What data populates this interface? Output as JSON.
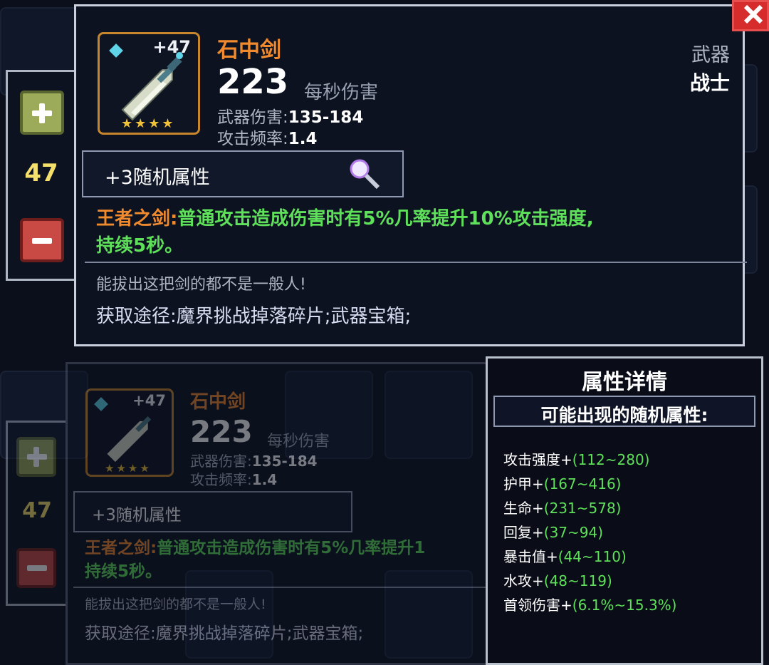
{
  "item": {
    "level": "+47",
    "name": "石中剑",
    "dps": "223",
    "dps_label": "每秒伤害",
    "weapon_damage_label": "武器伤害:",
    "weapon_damage": "135-184",
    "attack_rate_label": "攻击频率:",
    "attack_rate": "1.4",
    "category": "武器",
    "class": "战士",
    "stars": "★★★★",
    "random_attrs": "+3随机属性",
    "skill_name": "王者之剑:",
    "skill_text_line1": "普通攻击造成伤害时有5%几率提升10%攻击强度,",
    "skill_text_line2": "持续5秒。",
    "skill_text_short": "普通攻击造成伤害时有5%几率提升1",
    "flavor": "能拔出这把剑的都不是一般人!",
    "source": "获取途径:魔界挑战掉落碎片;武器宝箱;"
  },
  "side": {
    "qty": "47"
  },
  "attributes": {
    "title": "属性详情",
    "subtitle": "可能出现的随机属性:",
    "rows": [
      {
        "name": "攻击强度+",
        "range": "(112~280)"
      },
      {
        "name": "护甲+",
        "range": "(167~416)"
      },
      {
        "name": "生命+",
        "range": "(231~578)"
      },
      {
        "name": "回复+",
        "range": "(37~94)"
      },
      {
        "name": "暴击值+",
        "range": "(44~110)"
      },
      {
        "name": "水攻+",
        "range": "(48~119)"
      },
      {
        "name": "首领伤害+",
        "range": "(6.1%~15.3%)"
      }
    ]
  },
  "behind": {
    "class_fragment": "战士"
  },
  "colors": {
    "legendary": "#f08a2e",
    "skill": "#5ee05a",
    "qty": "#f4e06a"
  },
  "icons": [
    "sword-icon",
    "gem-icon",
    "magnifier-icon",
    "plus-icon",
    "minus-icon",
    "close-icon"
  ]
}
